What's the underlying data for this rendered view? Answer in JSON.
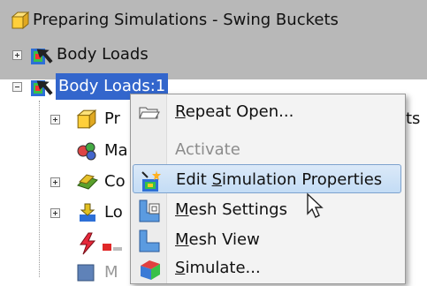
{
  "tree": {
    "root": {
      "label": "Preparing Simulations - Swing Buckets"
    },
    "items": [
      {
        "label": "Body Loads"
      },
      {
        "label": "Body Loads:1"
      }
    ],
    "children": [
      {
        "label": "Pr",
        "tail": "ts"
      },
      {
        "label": "Ma"
      },
      {
        "label": "Co"
      },
      {
        "label": "Lo"
      },
      {
        "label": ""
      },
      {
        "label": "M"
      }
    ]
  },
  "menu": {
    "items": [
      {
        "label": "Repeat Open...",
        "underline": "R",
        "rest": "epeat Open...",
        "icon": "open-folder-icon",
        "state": "normal"
      },
      {
        "label": "Activate",
        "state": "disabled",
        "icon": ""
      },
      {
        "label": "Edit Simulation Properties",
        "pre": "Edit ",
        "underline": "S",
        "rest": "imulation Properties",
        "icon": "edit-properties-icon",
        "state": "highlighted"
      },
      {
        "label": "Mesh Settings",
        "underline": "M",
        "rest": "esh Settings",
        "icon": "mesh-settings-icon",
        "state": "normal"
      },
      {
        "label": "Mesh View",
        "underline": "M",
        "rest": "esh View",
        "icon": "mesh-view-icon",
        "state": "normal"
      },
      {
        "label": "Simulate...",
        "underline": "S",
        "rest": "imulate...",
        "icon": "simulate-icon",
        "state": "normal"
      }
    ]
  },
  "colors": {
    "selection": "#3366cc",
    "menu_highlight": "#c3dcf5",
    "tree_background": "#b8b8b8"
  }
}
